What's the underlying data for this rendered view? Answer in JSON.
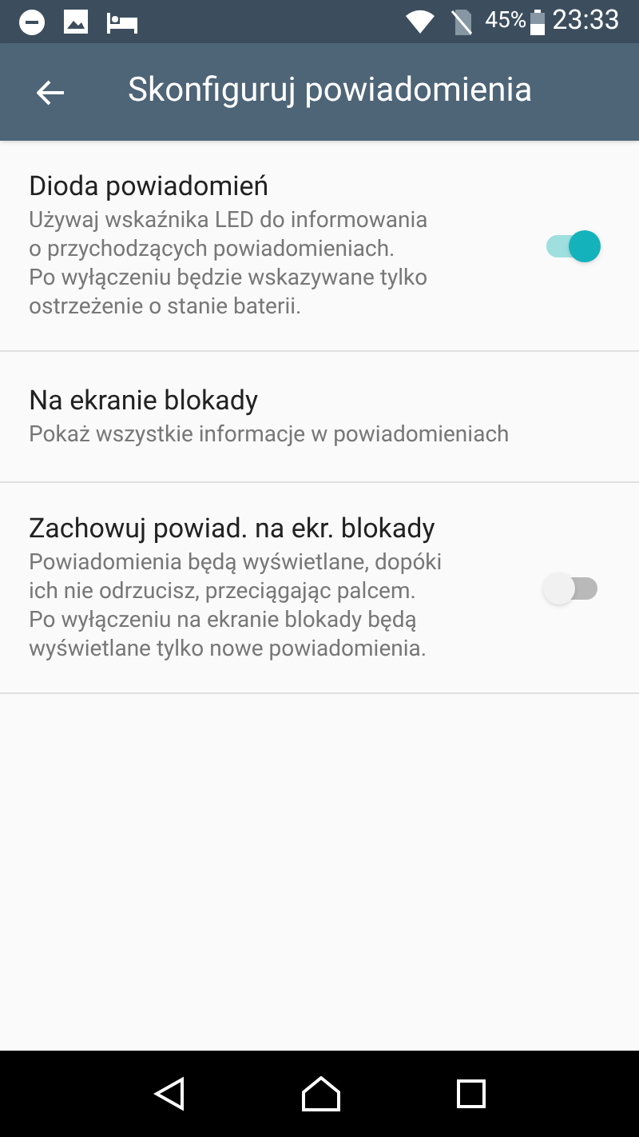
{
  "status_bar": {
    "battery": "45%",
    "time": "23:33"
  },
  "toolbar": {
    "title": "Skonfiguruj powiadomienia"
  },
  "settings": [
    {
      "kind": "switch",
      "title": "Dioda powiadomień",
      "summary": "Używaj wskaźnika LED do informowania\no przychodzących powiadomieniach.\nPo wyłączeniu będzie wskazywane tylko\nostrzeżenie o stanie baterii.",
      "on": true
    },
    {
      "kind": "text",
      "title": "Na ekranie blokady",
      "summary": "Pokaż wszystkie informacje w powiadomieniach"
    },
    {
      "kind": "switch",
      "title": "Zachowuj powiad. na ekr. blokady",
      "summary": "Powiadomienia będą wyświetlane, dopóki\nich nie odrzucisz, przeciągając palcem.\nPo wyłączeniu na ekranie blokady będą\nwyświetlane tylko nowe powiadomienia.",
      "on": false
    }
  ]
}
